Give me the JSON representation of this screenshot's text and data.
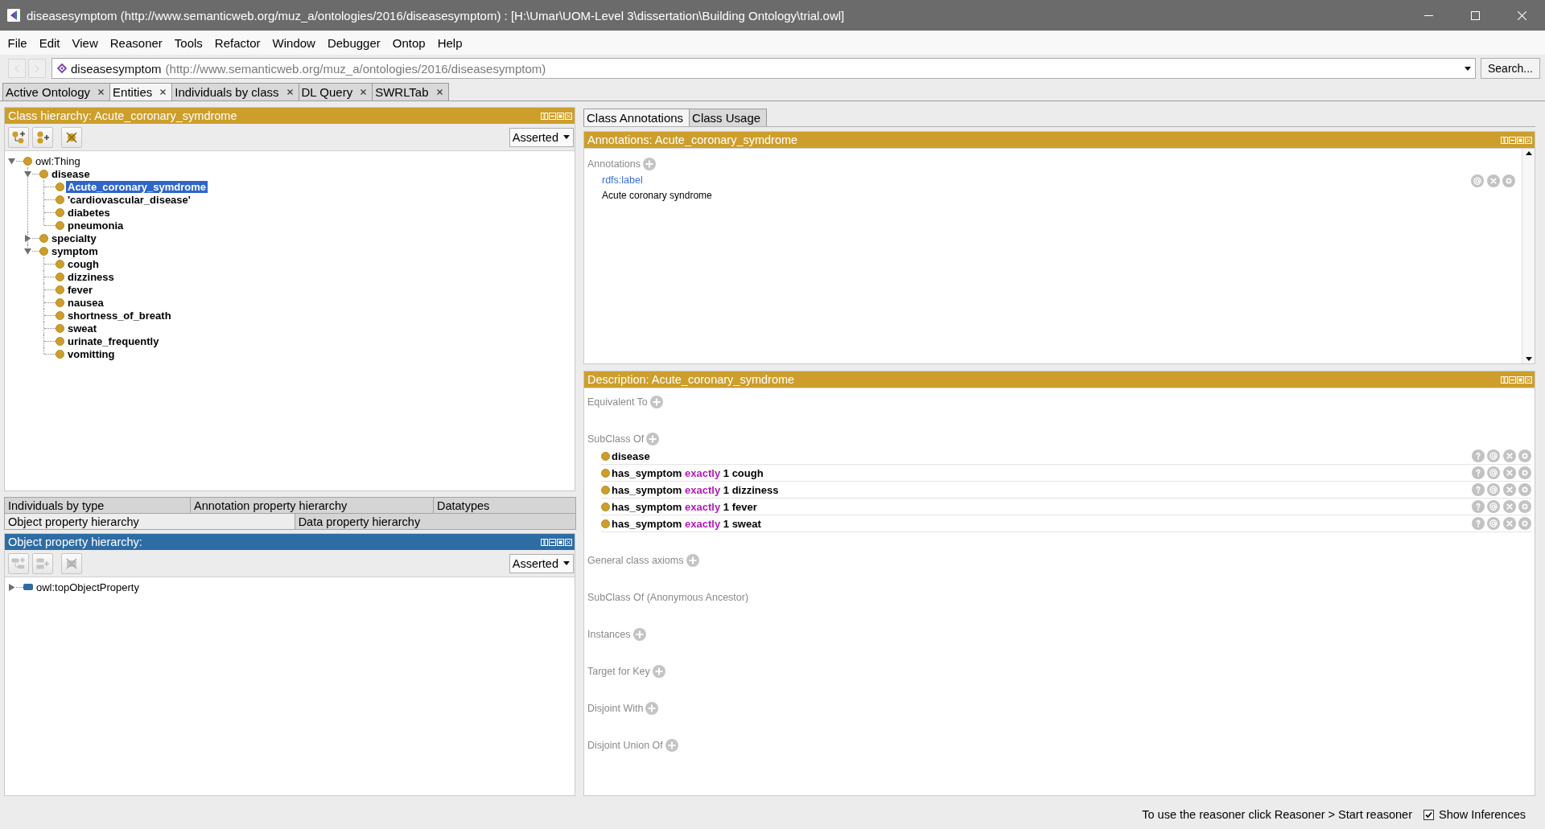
{
  "window": {
    "title": "diseasesymptom (http://www.semanticweb.org/muz_a/ontologies/2016/diseasesymptom) : [H:\\Umar\\UOM-Level 3\\dissertation\\Building Ontology\\trial.owl]"
  },
  "menu": [
    "File",
    "Edit",
    "View",
    "Reasoner",
    "Tools",
    "Refactor",
    "Window",
    "Debugger",
    "Ontop",
    "Help"
  ],
  "navigation": {
    "buttons": [
      {
        "kind": "back",
        "disabled": true
      },
      {
        "kind": "forward",
        "disabled": true
      }
    ],
    "ontology_name": "diseasesymptom",
    "ontology_iri": "(http://www.semanticweb.org/muz_a/ontologies/2016/diseasesymptom)",
    "search_button": "Search..."
  },
  "tabs": [
    {
      "label": "Active Ontology",
      "selected": false
    },
    {
      "label": "Entities",
      "selected": true
    },
    {
      "label": "Individuals by class",
      "selected": false
    },
    {
      "label": "DL Query",
      "selected": false
    },
    {
      "label": "SWRLTab",
      "selected": false
    }
  ],
  "class_hierarchy": {
    "title": "Class hierarchy: Acute_coronary_symdrome",
    "tools": [
      {
        "kind": "add_child",
        "disabled": false
      },
      {
        "kind": "add_sibling",
        "disabled": false
      },
      {
        "kind": "delete",
        "disabled": false
      }
    ],
    "mode": "Asserted",
    "tree": [
      {
        "label": "owl:Thing",
        "expanded": true,
        "selected": false,
        "children": [
          {
            "label": "disease",
            "expanded": true,
            "selected": false,
            "children": [
              {
                "label": "Acute_coronary_symdrome",
                "selected": true
              },
              {
                "label": "'cardiovascular_disease'",
                "selected": false
              },
              {
                "label": "diabetes",
                "selected": false
              },
              {
                "label": "pneumonia",
                "selected": false
              }
            ]
          },
          {
            "label": "specialty",
            "expanded": false,
            "selected": false
          },
          {
            "label": "symptom",
            "expanded": true,
            "selected": false,
            "children": [
              {
                "label": "cough",
                "selected": false
              },
              {
                "label": "dizziness",
                "selected": false
              },
              {
                "label": "fever",
                "selected": false
              },
              {
                "label": "nausea",
                "selected": false
              },
              {
                "label": "shortness_of_breath",
                "selected": false
              },
              {
                "label": "sweat",
                "selected": false
              },
              {
                "label": "urinate_frequently",
                "selected": false
              },
              {
                "label": "vomitting",
                "selected": false
              }
            ]
          }
        ]
      }
    ]
  },
  "view_tabs": [
    [
      {
        "label": "Individuals by type",
        "selected": false
      },
      {
        "label": "Annotation property hierarchy",
        "selected": false
      },
      {
        "label": "Datatypes",
        "selected": false
      }
    ],
    [
      {
        "label": "Object property hierarchy",
        "selected": true
      },
      {
        "label": "Data property hierarchy",
        "selected": false
      }
    ]
  ],
  "object_property_hierarchy": {
    "title": "Object property hierarchy:",
    "tools": [
      {
        "kind": "add_child",
        "disabled": true
      },
      {
        "kind": "add_sibling",
        "disabled": true
      },
      {
        "kind": "delete",
        "disabled": true
      }
    ],
    "mode": "Asserted",
    "tree": [
      {
        "label": "owl:topObjectProperty",
        "expanded": false,
        "selected": false
      }
    ]
  },
  "entity_tabs": [
    {
      "label": "Class Annotations",
      "selected": true
    },
    {
      "label": "Class Usage",
      "selected": false
    }
  ],
  "annotations": {
    "title": "Annotations: Acute_coronary_symdrome",
    "label": "Annotations",
    "items": [
      {
        "property": "rdfs:label",
        "value": "Acute coronary syndrome"
      }
    ]
  },
  "description": {
    "title": "Description: Acute_coronary_symdrome",
    "sections": [
      {
        "label": "Equivalent To",
        "can_add": true
      },
      {
        "label": "SubClass Of",
        "can_add": true,
        "items": [
          {
            "kind": "class",
            "name": "disease"
          },
          {
            "kind": "restriction",
            "property": "has_symptom",
            "quantifier": "exactly",
            "cardinality": "1",
            "filler": "cough"
          },
          {
            "kind": "restriction",
            "property": "has_symptom",
            "quantifier": "exactly",
            "cardinality": "1",
            "filler": "dizziness"
          },
          {
            "kind": "restriction",
            "property": "has_symptom",
            "quantifier": "exactly",
            "cardinality": "1",
            "filler": "fever"
          },
          {
            "kind": "restriction",
            "property": "has_symptom",
            "quantifier": "exactly",
            "cardinality": "1",
            "filler": "sweat"
          }
        ]
      },
      {
        "label": "General class axioms",
        "can_add": true
      },
      {
        "label": "SubClass Of (Anonymous Ancestor)",
        "can_add": false
      },
      {
        "label": "Instances",
        "can_add": true
      },
      {
        "label": "Target for Key",
        "can_add": true
      },
      {
        "label": "Disjoint With",
        "can_add": true
      },
      {
        "label": "Disjoint Union Of",
        "can_add": true
      }
    ]
  },
  "status_bar": {
    "message": "To use the reasoner click Reasoner > Start reasoner",
    "show_inferences": {
      "label": "Show Inferences",
      "checked": true
    }
  }
}
